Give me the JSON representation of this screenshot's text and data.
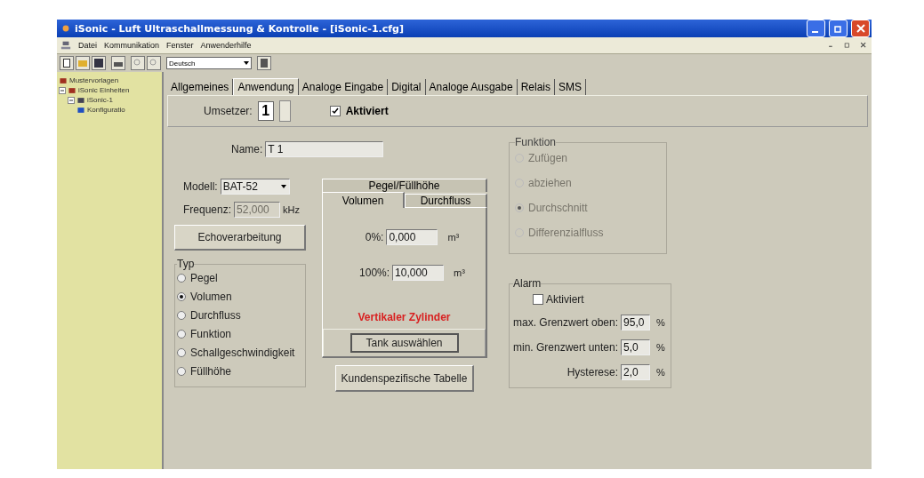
{
  "window": {
    "title": "iSonic - Luft Ultraschallmessung & Kontrolle - [iSonic-1.cfg]"
  },
  "menu": [
    "Datei",
    "Kommunikation",
    "Fenster",
    "Anwenderhilfe"
  ],
  "toolbar": {
    "language": "Deutsch"
  },
  "tree": [
    {
      "label": "Mustervorlagen"
    },
    {
      "label": "iSonic Einheiten",
      "expanded": true,
      "children": [
        {
          "label": "iSonic-1",
          "expanded": true,
          "children": [
            {
              "label": "Konfiguratio"
            }
          ]
        }
      ]
    }
  ],
  "tabs": [
    {
      "label": "Allgemeines",
      "selected": false
    },
    {
      "label": "Anwendung",
      "selected": true
    },
    {
      "label": "Analoge Eingabe",
      "selected": false
    },
    {
      "label": "Digital",
      "selected": false
    },
    {
      "label": "Analoge Ausgabe",
      "selected": false
    },
    {
      "label": "Relais",
      "selected": false
    },
    {
      "label": "SMS",
      "selected": false
    }
  ],
  "converter": {
    "label": "Umsetzer:",
    "value": "1",
    "enabled_label": "Aktiviert",
    "checked": true
  },
  "name": {
    "label": "Name:",
    "value": "T 1"
  },
  "model": {
    "label": "Modell:",
    "value": "BAT-52"
  },
  "frequency": {
    "label": "Frequenz:",
    "value": "52,000",
    "unit": "kHz",
    "disabled": true
  },
  "echo_button": "Echoverarbeitung",
  "type_group": {
    "title": "Typ",
    "options": [
      {
        "label": "Pegel",
        "selected": false
      },
      {
        "label": "Volumen",
        "selected": true
      },
      {
        "label": "Durchfluss",
        "selected": false
      },
      {
        "label": "Funktion",
        "selected": false
      },
      {
        "label": "Schallgeschwindigkeit",
        "selected": false
      },
      {
        "label": "Füllhöhe",
        "selected": false
      }
    ]
  },
  "inner_tabs": {
    "back_row": [
      {
        "label": "Pegel/Füllhöhe",
        "selected": false
      }
    ],
    "front_row": [
      {
        "label": "Volumen",
        "selected": true
      },
      {
        "label": "Durchfluss",
        "selected": false
      }
    ],
    "fields": [
      {
        "label": "0%:",
        "value": "0,000",
        "unit": "m³"
      },
      {
        "label": "100%:",
        "value": "10,000",
        "unit": "m³"
      }
    ],
    "shape": "Vertikaler Zylinder",
    "tank_button": "Tank auswählen"
  },
  "custom_table_button": "Kundenspezifische Tabelle",
  "function_group": {
    "title": "Funktion",
    "disabled": true,
    "options": [
      {
        "label": "Zufügen",
        "selected": false
      },
      {
        "label": "abziehen",
        "selected": false
      },
      {
        "label": "Durchschnitt",
        "selected": true
      },
      {
        "label": "Differenzialfluss",
        "selected": false
      }
    ]
  },
  "alarm": {
    "title": "Alarm",
    "enabled_label": "Aktiviert",
    "checked": false,
    "fields": [
      {
        "label": "max. Grenzwert oben:",
        "value": "95,0",
        "unit": "%"
      },
      {
        "label": "min. Grenzwert unten:",
        "value": "5,0",
        "unit": "%"
      },
      {
        "label": "Hysterese:",
        "value": "2,0",
        "unit": "%"
      }
    ]
  }
}
